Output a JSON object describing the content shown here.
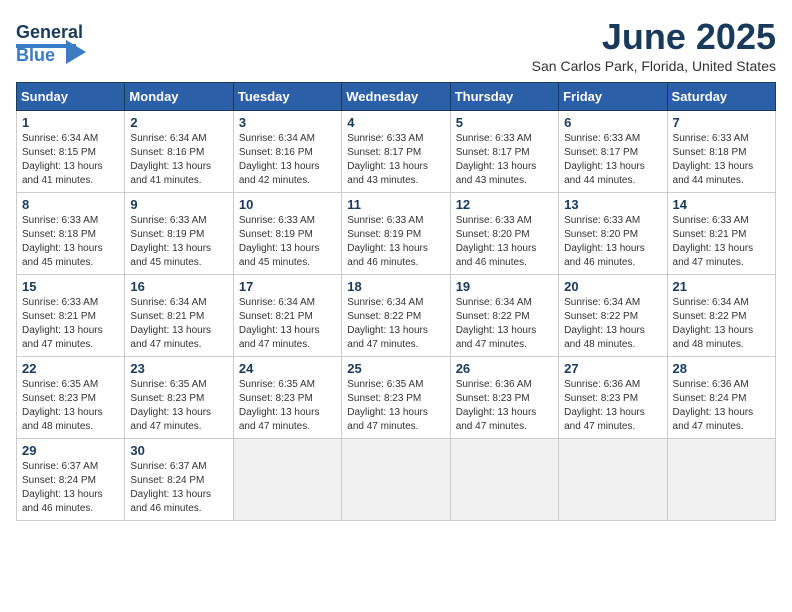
{
  "header": {
    "logo_general": "General",
    "logo_blue": "Blue",
    "month_title": "June 2025",
    "location": "San Carlos Park, Florida, United States"
  },
  "days_of_week": [
    "Sunday",
    "Monday",
    "Tuesday",
    "Wednesday",
    "Thursday",
    "Friday",
    "Saturday"
  ],
  "weeks": [
    [
      {
        "day": "1",
        "sunrise": "6:34 AM",
        "sunset": "8:15 PM",
        "daylight": "13 hours and 41 minutes."
      },
      {
        "day": "2",
        "sunrise": "6:34 AM",
        "sunset": "8:16 PM",
        "daylight": "13 hours and 41 minutes."
      },
      {
        "day": "3",
        "sunrise": "6:34 AM",
        "sunset": "8:16 PM",
        "daylight": "13 hours and 42 minutes."
      },
      {
        "day": "4",
        "sunrise": "6:33 AM",
        "sunset": "8:17 PM",
        "daylight": "13 hours and 43 minutes."
      },
      {
        "day": "5",
        "sunrise": "6:33 AM",
        "sunset": "8:17 PM",
        "daylight": "13 hours and 43 minutes."
      },
      {
        "day": "6",
        "sunrise": "6:33 AM",
        "sunset": "8:17 PM",
        "daylight": "13 hours and 44 minutes."
      },
      {
        "day": "7",
        "sunrise": "6:33 AM",
        "sunset": "8:18 PM",
        "daylight": "13 hours and 44 minutes."
      }
    ],
    [
      {
        "day": "8",
        "sunrise": "6:33 AM",
        "sunset": "8:18 PM",
        "daylight": "13 hours and 45 minutes."
      },
      {
        "day": "9",
        "sunrise": "6:33 AM",
        "sunset": "8:19 PM",
        "daylight": "13 hours and 45 minutes."
      },
      {
        "day": "10",
        "sunrise": "6:33 AM",
        "sunset": "8:19 PM",
        "daylight": "13 hours and 45 minutes."
      },
      {
        "day": "11",
        "sunrise": "6:33 AM",
        "sunset": "8:19 PM",
        "daylight": "13 hours and 46 minutes."
      },
      {
        "day": "12",
        "sunrise": "6:33 AM",
        "sunset": "8:20 PM",
        "daylight": "13 hours and 46 minutes."
      },
      {
        "day": "13",
        "sunrise": "6:33 AM",
        "sunset": "8:20 PM",
        "daylight": "13 hours and 46 minutes."
      },
      {
        "day": "14",
        "sunrise": "6:33 AM",
        "sunset": "8:21 PM",
        "daylight": "13 hours and 47 minutes."
      }
    ],
    [
      {
        "day": "15",
        "sunrise": "6:33 AM",
        "sunset": "8:21 PM",
        "daylight": "13 hours and 47 minutes."
      },
      {
        "day": "16",
        "sunrise": "6:34 AM",
        "sunset": "8:21 PM",
        "daylight": "13 hours and 47 minutes."
      },
      {
        "day": "17",
        "sunrise": "6:34 AM",
        "sunset": "8:21 PM",
        "daylight": "13 hours and 47 minutes."
      },
      {
        "day": "18",
        "sunrise": "6:34 AM",
        "sunset": "8:22 PM",
        "daylight": "13 hours and 47 minutes."
      },
      {
        "day": "19",
        "sunrise": "6:34 AM",
        "sunset": "8:22 PM",
        "daylight": "13 hours and 47 minutes."
      },
      {
        "day": "20",
        "sunrise": "6:34 AM",
        "sunset": "8:22 PM",
        "daylight": "13 hours and 48 minutes."
      },
      {
        "day": "21",
        "sunrise": "6:34 AM",
        "sunset": "8:22 PM",
        "daylight": "13 hours and 48 minutes."
      }
    ],
    [
      {
        "day": "22",
        "sunrise": "6:35 AM",
        "sunset": "8:23 PM",
        "daylight": "13 hours and 48 minutes."
      },
      {
        "day": "23",
        "sunrise": "6:35 AM",
        "sunset": "8:23 PM",
        "daylight": "13 hours and 47 minutes."
      },
      {
        "day": "24",
        "sunrise": "6:35 AM",
        "sunset": "8:23 PM",
        "daylight": "13 hours and 47 minutes."
      },
      {
        "day": "25",
        "sunrise": "6:35 AM",
        "sunset": "8:23 PM",
        "daylight": "13 hours and 47 minutes."
      },
      {
        "day": "26",
        "sunrise": "6:36 AM",
        "sunset": "8:23 PM",
        "daylight": "13 hours and 47 minutes."
      },
      {
        "day": "27",
        "sunrise": "6:36 AM",
        "sunset": "8:23 PM",
        "daylight": "13 hours and 47 minutes."
      },
      {
        "day": "28",
        "sunrise": "6:36 AM",
        "sunset": "8:24 PM",
        "daylight": "13 hours and 47 minutes."
      }
    ],
    [
      {
        "day": "29",
        "sunrise": "6:37 AM",
        "sunset": "8:24 PM",
        "daylight": "13 hours and 46 minutes."
      },
      {
        "day": "30",
        "sunrise": "6:37 AM",
        "sunset": "8:24 PM",
        "daylight": "13 hours and 46 minutes."
      },
      null,
      null,
      null,
      null,
      null
    ]
  ],
  "labels": {
    "sunrise": "Sunrise:",
    "sunset": "Sunset:",
    "daylight": "Daylight:"
  }
}
